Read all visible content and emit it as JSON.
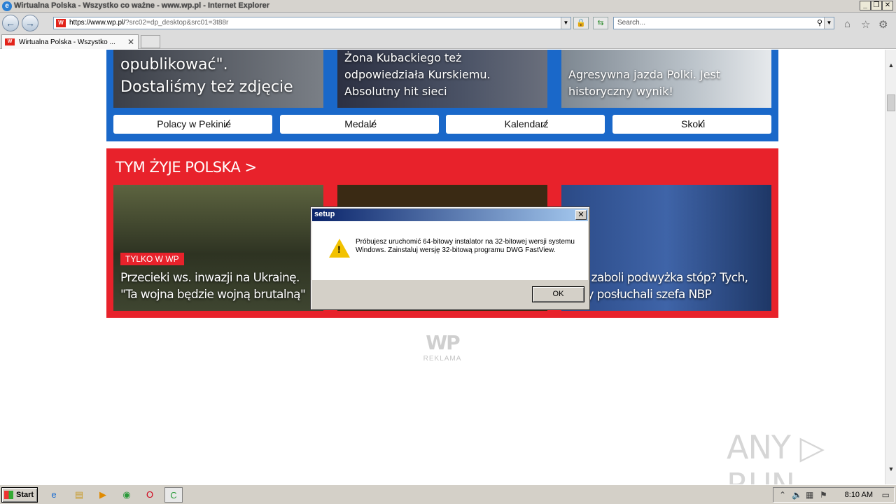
{
  "window": {
    "title": "Wirtualna Polska - Wszystko co ważne - www.wp.pl - Internet Explorer",
    "minimize": "_",
    "restore": "❐",
    "close": "✕"
  },
  "address": {
    "url_host": "https://www.wp.pl/",
    "url_query": "?src02=dp_desktop&src01=3t88r"
  },
  "search": {
    "placeholder": "Search..."
  },
  "tab": {
    "label": "Wirtualna Polska - Wszystko ...",
    "close": "✕"
  },
  "blue_cards": [
    {
      "text1": "opublikować\".",
      "text2": "Dostaliśmy też zdjęcie"
    },
    {
      "text1": "Żona Kubackiego też",
      "text2": "odpowiedziała Kurskiemu.",
      "text3": "Absolutny hit sieci"
    },
    {
      "text1": "Agresywna jazda Polki. Jest",
      "text2": "historyczny wynik!"
    }
  ],
  "pills": [
    "Polacy w Pekinie",
    "Medale",
    "Kalendarz",
    "Skoki"
  ],
  "red": {
    "heading": "TYM ŻYJE POLSKA >",
    "badge": "TYLKO W WP",
    "card1": {
      "line1": "Przecieki ws. inwazji na Ukrainę.",
      "line2": "\"Ta wojna będzie wojną brutalną\""
    },
    "card3": {
      "line1": "o zaboli podwyżka stóp? Tych,",
      "line2": "zy posłuchali szefa NBP"
    }
  },
  "ad": {
    "logo": "WP",
    "label": "REKLAMA"
  },
  "watermark": "ANY ▷ RUN",
  "dialog": {
    "title": "setup",
    "message": "Próbujesz uruchomić 64-bitowy instalator na 32-bitowej wersji systemu Windows. Zainstaluj wersję 32-bitową programu DWG FastView.",
    "ok": "OK"
  },
  "taskbar": {
    "start": "Start",
    "time": "8:10 AM"
  }
}
